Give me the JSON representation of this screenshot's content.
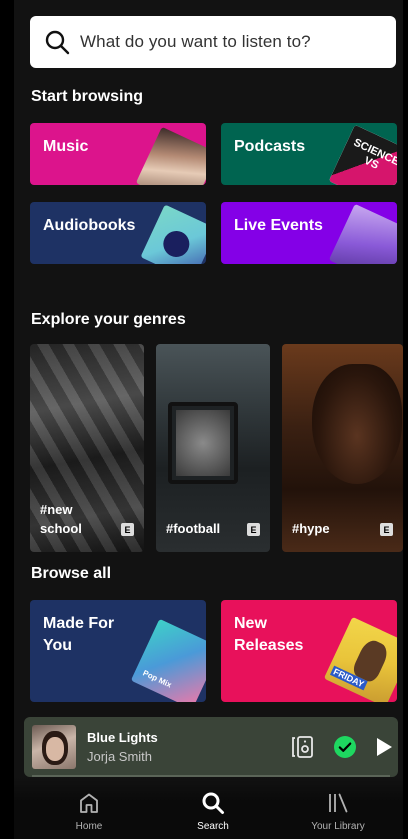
{
  "search": {
    "placeholder": "What do you want to listen to?"
  },
  "sections": {
    "start_browsing": "Start browsing",
    "explore_genres": "Explore your genres",
    "browse_all": "Browse all"
  },
  "start_browsing": [
    {
      "label": "Music",
      "color": "#dc148c"
    },
    {
      "label": "Podcasts",
      "color": "#006450"
    },
    {
      "label": "Audiobooks",
      "color": "#1e3264"
    },
    {
      "label": "Live Events",
      "color": "#8400e7"
    }
  ],
  "podcasts_art_text": "SCIENCE VS",
  "genres": [
    {
      "tag": "#new school",
      "badge": "E"
    },
    {
      "tag": "#football",
      "badge": "E"
    },
    {
      "tag": "#hype",
      "badge": "E"
    }
  ],
  "browse_all": [
    {
      "label": "Made For You",
      "color": "#1e3264",
      "art_text": "Pop Mix"
    },
    {
      "label": "New Releases",
      "color": "#e8115b",
      "art_text": "FRIDAY"
    }
  ],
  "now_playing": {
    "title": "Blue Lights",
    "artist": "Jorja Smith",
    "accent": "#1ed760"
  },
  "nav": [
    {
      "label": "Home",
      "icon": "home-icon"
    },
    {
      "label": "Search",
      "icon": "search-icon"
    },
    {
      "label": "Your Library",
      "icon": "library-icon"
    }
  ]
}
